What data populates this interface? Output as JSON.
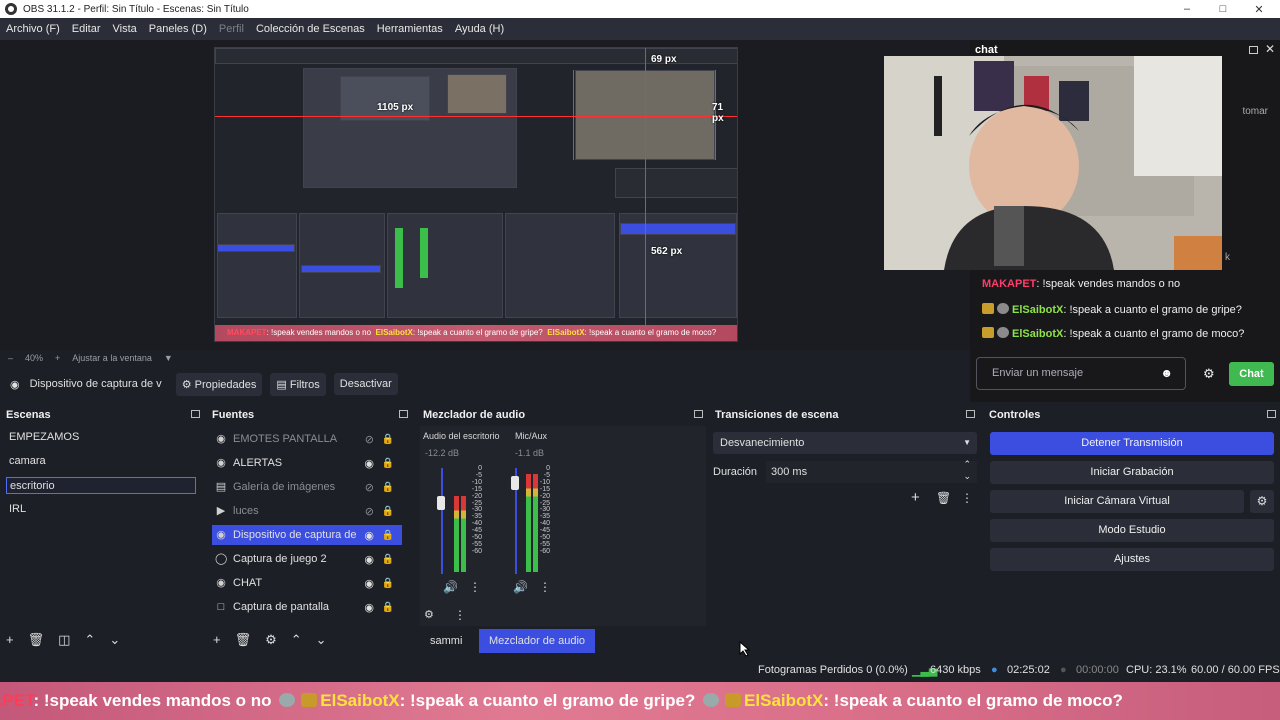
{
  "window": {
    "title": "OBS 31.1.2 - Perfil: Sin Título - Escenas: Sin Título"
  },
  "menu": [
    "Archivo (F)",
    "Editar",
    "Vista",
    "Paneles (D)",
    "Perfil",
    "Colección de Escenas",
    "Herramientas",
    "Ayuda (H)"
  ],
  "preview": {
    "labels": {
      "top": "69 px",
      "right": "71 px",
      "mid": "1105 px",
      "bottom": "562 px"
    },
    "banner": {
      "u1": "MAKAPET",
      "m1": ": !speak vendes mandos o no",
      "u2": "ElSaibotX",
      "m2": ": !speak a cuanto el gramo de gripe?",
      "u3": "ElSaibotX",
      "m3": ": !speak a cuanto el gramo de moco?"
    },
    "zoom": "40%",
    "fit_label": "Ajustar a la ventana"
  },
  "chat": {
    "title": "chat",
    "side_text": {
      "t1": "tomar",
      "t2": "k"
    },
    "messages": [
      {
        "user": "MAKAPET",
        "text": ": !speak vendes mandos o no"
      },
      {
        "user": "ElSaibotX",
        "text": ": !speak a cuanto el gramo de gripe?"
      },
      {
        "user": "ElSaibotX",
        "text": ": !speak a cuanto el gramo de moco?"
      }
    ],
    "input_placeholder": "Enviar un mensaje",
    "send_label": "Chat"
  },
  "source_toolbar": {
    "source_name": "Dispositivo de captura de v",
    "properties": "Propiedades",
    "filters": "Filtros",
    "deactivate": "Desactivar"
  },
  "scenes": {
    "title": "Escenas",
    "items": [
      "EMPEZAMOS",
      "camara",
      "escritorio",
      "IRL"
    ],
    "selected": "escritorio"
  },
  "sources": {
    "title": "Fuentes",
    "items": [
      {
        "name": "EMOTES PANTALLA",
        "hidden": true
      },
      {
        "name": "ALERTAS",
        "hidden": false
      },
      {
        "name": "Galería de imágenes",
        "hidden": true
      },
      {
        "name": "luces",
        "hidden": true
      },
      {
        "name": "Dispositivo de captura de",
        "hidden": false
      },
      {
        "name": "Captura de juego 2",
        "hidden": false
      },
      {
        "name": "CHAT",
        "hidden": false
      },
      {
        "name": "Captura de pantalla",
        "hidden": false
      }
    ]
  },
  "mixer": {
    "title": "Mezclador de audio",
    "channels": [
      {
        "name": "Audio del escritorio",
        "db": "-12.2 dB",
        "level": 0.72
      },
      {
        "name": "Mic/Aux",
        "db": "-1.1 dB",
        "level": 0.92
      }
    ],
    "scale": [
      "0",
      "-5",
      "-10",
      "-15",
      "-20",
      "-25",
      "-30",
      "-35",
      "-40",
      "-45",
      "-50",
      "-55",
      "-60"
    ],
    "tabs": [
      "sammi",
      "Mezclador de audio"
    ]
  },
  "transitions": {
    "title": "Transiciones de escena",
    "selected": "Desvanecimiento",
    "duration_label": "Duración",
    "duration_value": "300 ms"
  },
  "controls": {
    "title": "Controles",
    "buttons": [
      "Detener Transmisión",
      "Iniciar Grabación",
      "Iniciar Cámara Virtual",
      "Modo Estudio",
      "Ajustes"
    ]
  },
  "status": {
    "dropped": "Fotogramas Perdidos 0 (0.0%)",
    "bitrate": "6430 kbps",
    "stream_time": "02:25:02",
    "rec_time": "00:00:00",
    "cpu": "CPU: 23.1%",
    "fps": "60.00 / 60.00 FPS"
  },
  "banner": {
    "u1": "APET",
    "m1": ": !speak vendes mandos o no",
    "u2": "ElSaibotX",
    "m2": ": !speak a cuanto el gramo de gripe?",
    "u3": "ElSaibotX",
    "m3": ": !speak a cuanto el gramo de moco?"
  },
  "colors": {
    "accent": "#3b4ee0",
    "live_green": "#3fb950",
    "meter_green": "#3cbf4a",
    "meter_red": "#d93838"
  }
}
